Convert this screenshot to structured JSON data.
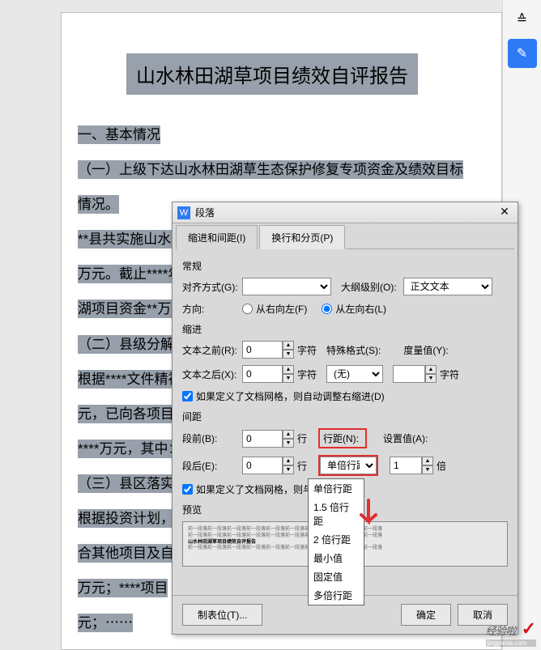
{
  "sidebar": {
    "icon1": "≙",
    "icon2": "✎"
  },
  "doc": {
    "title": "山水林田湖草项目绩效自评报告",
    "lines": [
      "一、基本情况",
      "（一）上级下达山水林田湖草生态保护修复专项资金及绩效目标",
      "情况。",
      "**县共实施山水林",
      "万元。截止****年",
      "湖项目资金**万元",
      "（二）县级分解下",
      "根据****文件精神",
      "元，已向各项目实施",
      "****万元，其中：",
      "（三）县区落实配",
      "根据投资计划，计",
      "合其他项目及自筹",
      "万元；****项目",
      "元；⋯⋯"
    ]
  },
  "dialog": {
    "title": "段落",
    "tabs": {
      "t1": "缩进和间距(I)",
      "t2": "换行和分页(P)"
    },
    "general": "常规",
    "alignLabel": "对齐方式(G):",
    "outlineLabel": "大纲级别(O):",
    "outlineValue": "正文文本",
    "dirLabel": "方向:",
    "dirRL": "从右向左(F)",
    "dirLR": "从左向右(L)",
    "indent": "缩进",
    "beforeText": "文本之前(R):",
    "afterText": "文本之后(X):",
    "unitChar": "字符",
    "special": "特殊格式(S):",
    "specialVal": "(无)",
    "measure": "度量值(Y):",
    "zero": "0",
    "gridAdjust": "如果定义了文档网格，则自动调整右缩进(D)",
    "spacing": "间距",
    "before": "段前(B):",
    "after": "段后(E):",
    "unitLine": "行",
    "lineSpacing": "行距(N):",
    "lineSpacingVal": "单倍行距",
    "setVal": "设置值(A):",
    "one": "1",
    "unitTimes": "倍",
    "gridAlign": "如果定义了文档网格，则与网格对",
    "dropdown": [
      "单倍行距",
      "1.5 倍行距",
      "2 倍行距",
      "最小值",
      "固定值",
      "多倍行距"
    ],
    "preview": "预览",
    "previewLine1": "前一段落前一段落前一段落前一段落前一段落前一段落前一段落前一段落前一段落前一段落",
    "previewLine2": "山水林田湖草项目绩效自评报告",
    "tabStops": "制表位(T)...",
    "ok": "确定",
    "cancel": "取消"
  },
  "watermark": {
    "text": "经验啦",
    "sub": "jingyanla.com"
  }
}
